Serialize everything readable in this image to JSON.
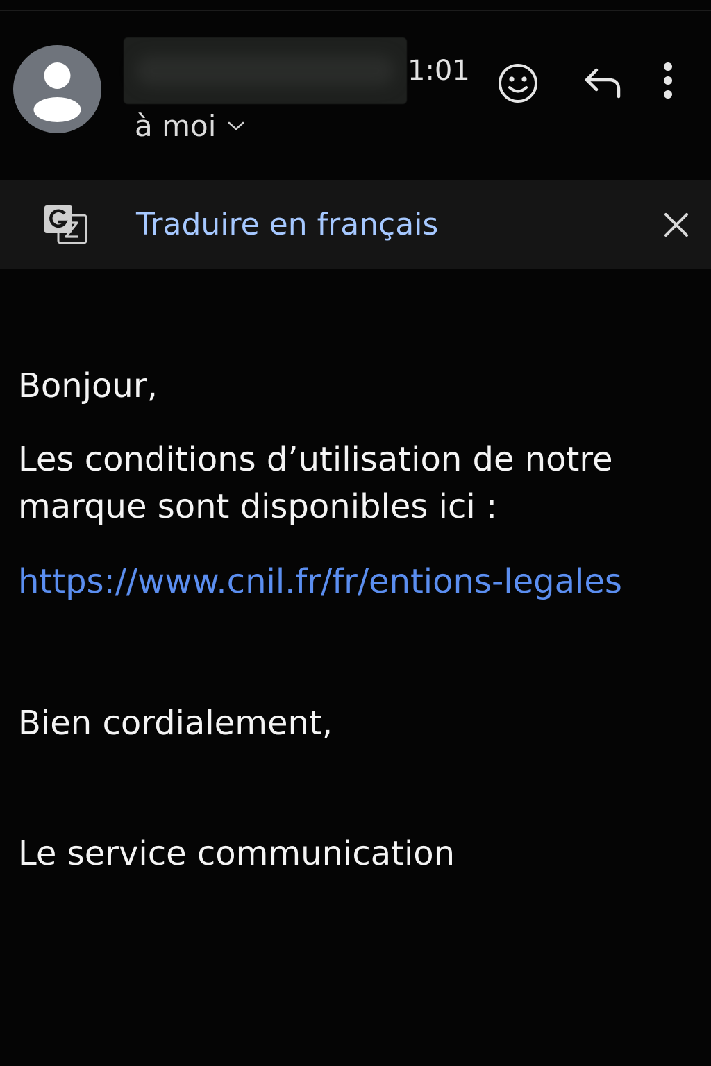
{
  "header": {
    "time": "1:01",
    "recipient_label": "à moi",
    "icons": {
      "avatar": "person-icon",
      "react": "emoji-icon",
      "reply": "reply-icon",
      "more": "more-vert-icon",
      "expand": "chevron-down-icon"
    }
  },
  "translate_bar": {
    "label": "Traduire en français",
    "icon": "translate-icon",
    "close_icon": "close-icon"
  },
  "message": {
    "greeting": "Bonjour,",
    "paragraph_line1": "Les conditions d’utilisation de notre",
    "paragraph_line2": "marque sont disponibles ici :",
    "link_text": "https://www.cnil.fr/fr/entions-legales",
    "closing": "Bien cordialement,",
    "signature": "Le service communication"
  },
  "colors": {
    "background": "#050505",
    "translate_bar": "#151515",
    "translate_text": "#a6c8ff",
    "link": "#5b8ef0",
    "avatar": "#6f747c"
  }
}
